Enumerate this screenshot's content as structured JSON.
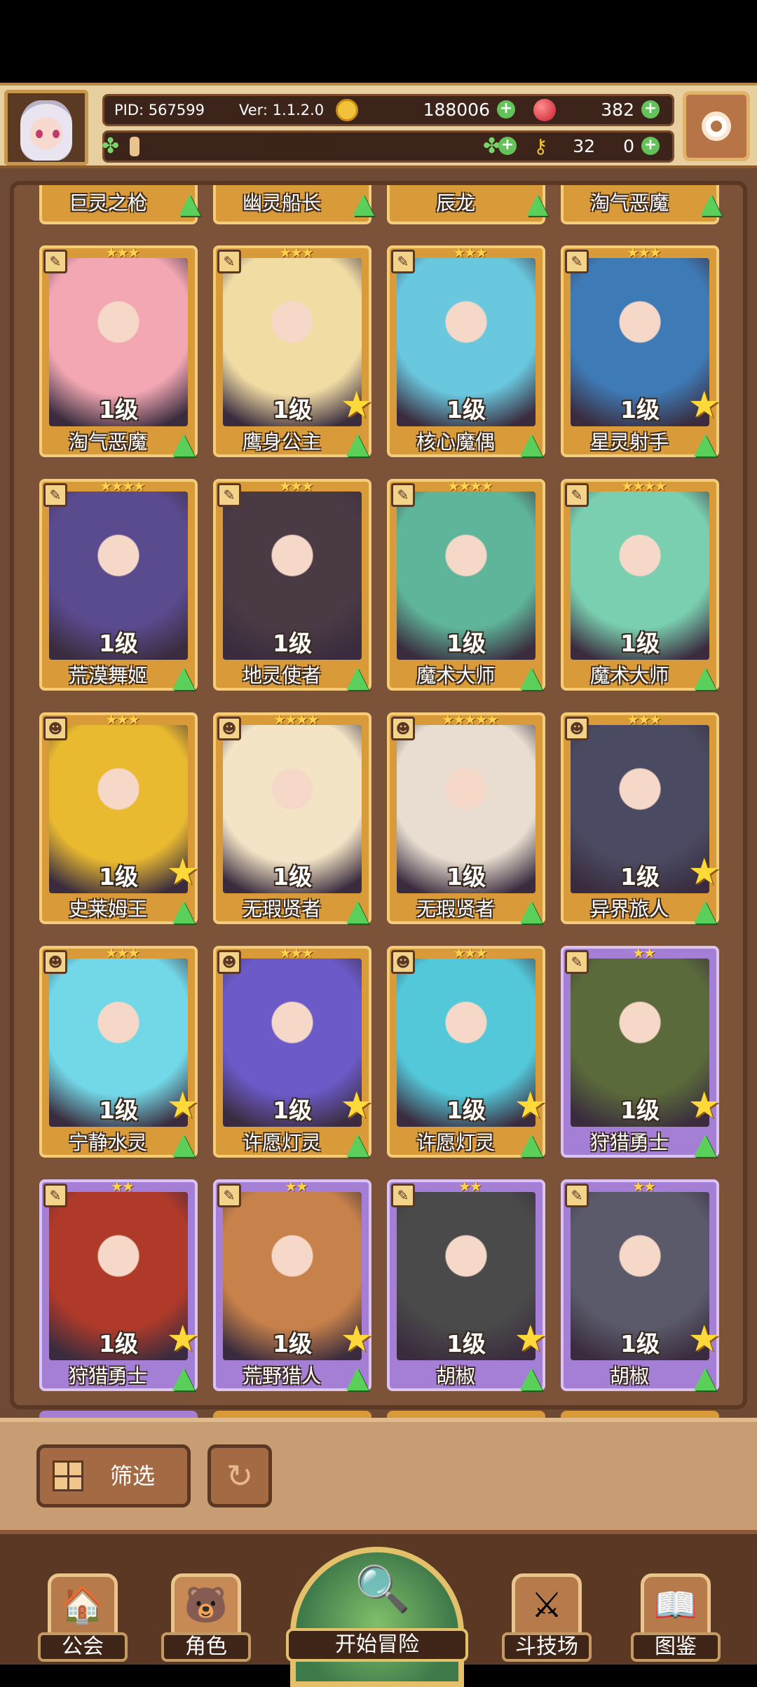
{
  "header": {
    "pid": "PID: 567599",
    "version": "Ver: 1.1.2.0",
    "gold": "188006",
    "gems": "382",
    "xp": "21/1500",
    "xp_fraction": 0.014,
    "clover": "32",
    "keys": "0",
    "plus": "+"
  },
  "partial_row": [
    "巨灵之枪",
    "幽灵船长",
    "辰龙",
    "淘气恶魔"
  ],
  "cards": [
    {
      "name": "淘气恶魔",
      "level": "1级",
      "stars": "★★★",
      "rarity": "gold",
      "featured": false
    },
    {
      "name": "鹰身公主",
      "level": "1级",
      "stars": "★★★",
      "rarity": "gold",
      "featured": true
    },
    {
      "name": "核心魔偶",
      "level": "1级",
      "stars": "★★★",
      "rarity": "gold",
      "featured": false
    },
    {
      "name": "星灵射手",
      "level": "1级",
      "stars": "★★★",
      "rarity": "gold",
      "featured": true
    },
    {
      "name": "荒漠舞姬",
      "level": "1级",
      "stars": "★★★★",
      "rarity": "gold",
      "featured": false
    },
    {
      "name": "地灵使者",
      "level": "1级",
      "stars": "★★★",
      "rarity": "gold",
      "featured": false
    },
    {
      "name": "魔术大师",
      "level": "1级",
      "stars": "★★★★",
      "rarity": "gold",
      "featured": false
    },
    {
      "name": "魔术大师",
      "level": "1级",
      "stars": "★★★★",
      "rarity": "gold",
      "featured": false
    },
    {
      "name": "史莱姆王",
      "level": "1级",
      "stars": "★★★",
      "rarity": "gold",
      "featured": true
    },
    {
      "name": "无瑕贤者",
      "level": "1级",
      "stars": "★★★★",
      "rarity": "gold",
      "featured": false
    },
    {
      "name": "无瑕贤者",
      "level": "1级",
      "stars": "★★★★★",
      "rarity": "gold",
      "featured": false
    },
    {
      "name": "异界旅人",
      "level": "1级",
      "stars": "★★★",
      "rarity": "gold",
      "featured": true
    },
    {
      "name": "宁静水灵",
      "level": "1级",
      "stars": "★★★",
      "rarity": "gold",
      "featured": true
    },
    {
      "name": "许愿灯灵",
      "level": "1级",
      "stars": "★★★",
      "rarity": "gold",
      "featured": true
    },
    {
      "name": "许愿灯灵",
      "level": "1级",
      "stars": "★★★",
      "rarity": "gold",
      "featured": true
    },
    {
      "name": "狩猎勇士",
      "level": "1级",
      "stars": "★★",
      "rarity": "purple",
      "featured": true
    },
    {
      "name": "狩猎勇士",
      "level": "1级",
      "stars": "★★",
      "rarity": "purple",
      "featured": true
    },
    {
      "name": "荒野猎人",
      "level": "1级",
      "stars": "★★",
      "rarity": "purple",
      "featured": true
    },
    {
      "name": "胡椒",
      "level": "1级",
      "stars": "★★",
      "rarity": "purple",
      "featured": true
    },
    {
      "name": "胡椒",
      "level": "1级",
      "stars": "★★",
      "rarity": "purple",
      "featured": true
    }
  ],
  "controls": {
    "filter_label": "筛选",
    "reset_glyph": "↻"
  },
  "nav": {
    "guild": "公会",
    "character": "角色",
    "adventure": "开始冒险",
    "arena": "斗技场",
    "codex": "图鉴"
  },
  "palette": {
    "art": [
      "#f3a7b3",
      "#f1dca4",
      "#69c7de",
      "#3e7ab5",
      "#5a4a8e",
      "#4a3a44",
      "#5fb59a",
      "#7acfb0",
      "#e9b930",
      "#f3e4c6",
      "#e8ddd0",
      "#4a4a62",
      "#72d7e6",
      "#6b5ac7",
      "#53c8d9",
      "#5a6a3a",
      "#b03a2a",
      "#c7814a",
      "#4a4a4a",
      "#5a5a6a"
    ]
  }
}
